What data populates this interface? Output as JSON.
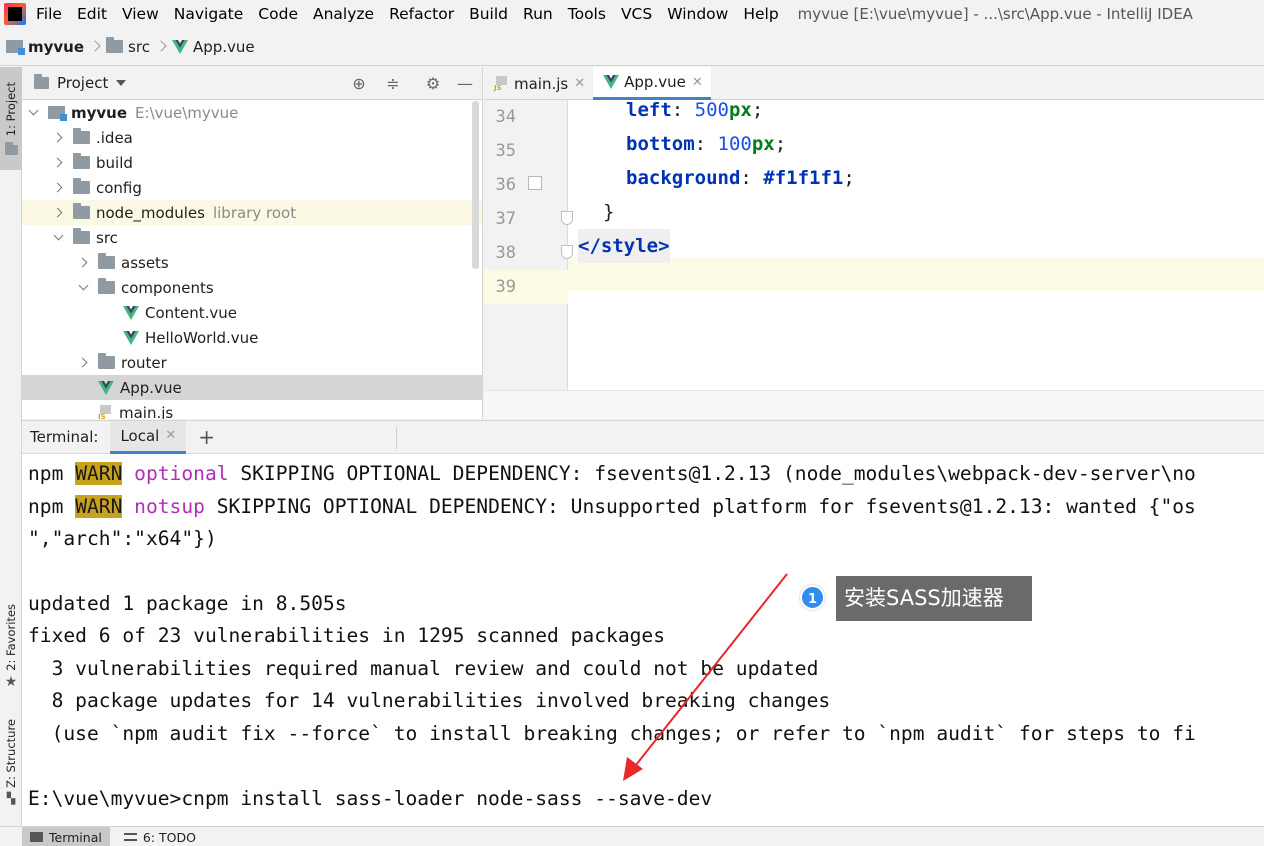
{
  "window_title": "myvue [E:\\vue\\myvue] - ...\\src\\App.vue - IntelliJ IDEA",
  "menu": [
    "File",
    "Edit",
    "View",
    "Navigate",
    "Code",
    "Analyze",
    "Refactor",
    "Build",
    "Run",
    "Tools",
    "VCS",
    "Window",
    "Help"
  ],
  "breadcrumb": {
    "project": "myvue",
    "folder": "src",
    "file": "App.vue"
  },
  "left_strip": {
    "project": "1: Project",
    "favorites": "2: Favorites",
    "structure": "Z: Structure"
  },
  "project_panel": {
    "title": "Project",
    "tree": [
      {
        "name": "myvue",
        "hint": "E:\\vue\\myvue",
        "type": "module",
        "arrow": "down",
        "depth": 0
      },
      {
        "name": ".idea",
        "type": "folder",
        "arrow": "right",
        "depth": 1
      },
      {
        "name": "build",
        "type": "folder",
        "arrow": "right",
        "depth": 1
      },
      {
        "name": "config",
        "type": "folder",
        "arrow": "right",
        "depth": 1
      },
      {
        "name": "node_modules",
        "hint": "library root",
        "type": "folder",
        "arrow": "right",
        "depth": 1
      },
      {
        "name": "src",
        "type": "folder",
        "arrow": "down",
        "depth": 1
      },
      {
        "name": "assets",
        "type": "folder",
        "arrow": "right",
        "depth": 2
      },
      {
        "name": "components",
        "type": "folder",
        "arrow": "down",
        "depth": 2
      },
      {
        "name": "Content.vue",
        "type": "vue",
        "arrow": "none",
        "depth": 3
      },
      {
        "name": "HelloWorld.vue",
        "type": "vue",
        "arrow": "none",
        "depth": 3
      },
      {
        "name": "router",
        "type": "folder",
        "arrow": "right",
        "depth": 2
      },
      {
        "name": "App.vue",
        "type": "vue",
        "arrow": "none",
        "depth": 2
      },
      {
        "name": "main.js",
        "type": "js",
        "arrow": "none",
        "depth": 2
      }
    ]
  },
  "editor": {
    "tabs": [
      {
        "label": "main.js",
        "icon": "js-icon"
      },
      {
        "label": "App.vue",
        "icon": "vue-icon",
        "active": true
      }
    ],
    "line_numbers": [
      "34",
      "35",
      "36",
      "37",
      "38",
      "39"
    ],
    "code": {
      "l34": {
        "prop": "left",
        "num": "500",
        "unit": "px"
      },
      "l35": {
        "prop": "bottom",
        "num": "100",
        "unit": "px"
      },
      "l36": {
        "prop": "background",
        "value": "#f1f1f1"
      },
      "l37": "}",
      "l38": "</style>"
    }
  },
  "terminal": {
    "title": "Terminal:",
    "tab": "Local",
    "lines": {
      "l1_npm": "npm ",
      "l1_warn": "WARN",
      "l1_opt": "optional",
      "l1_rest": " SKIPPING OPTIONAL DEPENDENCY: fsevents@1.2.13 (node_modules\\webpack-dev-server\\no",
      "l2_npm": "npm ",
      "l2_warn": "WARN",
      "l2_opt": "notsup",
      "l2_rest": " SKIPPING OPTIONAL DEPENDENCY: Unsupported platform for fsevents@1.2.13: wanted {\"os",
      "l3": "\",\"arch\":\"x64\"})",
      "l4": "updated 1 package in 8.505s",
      "l5": "fixed 6 of 23 vulnerabilities in 1295 scanned packages",
      "l6": "  3 vulnerabilities required manual review and could not be updated",
      "l7": "  8 package updates for 14 vulnerabilities involved breaking changes",
      "l8": "  (use `npm audit fix --force` to install breaking changes; or refer to `npm audit` for steps to fi",
      "l9": "E:\\vue\\myvue>cnpm install sass-loader node-sass --save-dev"
    }
  },
  "bottom_bar": {
    "terminal": "Terminal",
    "todo": "6: TODO"
  },
  "annotation": {
    "badge": "1",
    "text": "安装SASS加速器",
    "arrow_color": "#e8282b"
  },
  "colors": {
    "accent": "#4083c9",
    "warn_bg": "#c7a21c",
    "keyword": "#0033b3",
    "number": "#1750eb",
    "unit": "#067d17"
  }
}
